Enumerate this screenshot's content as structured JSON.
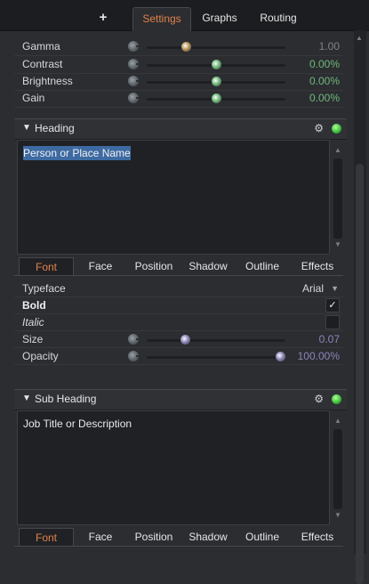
{
  "top_tabs": {
    "add_label": "+",
    "settings": "Settings",
    "graphs": "Graphs",
    "routing": "Routing"
  },
  "adjustments": [
    {
      "label": "Gamma",
      "value": "1.00",
      "position": 0.27,
      "thumb_color": "#b8955a"
    },
    {
      "label": "Contrast",
      "value": "0.00%",
      "position": 0.5,
      "thumb_color": "#6fb87a"
    },
    {
      "label": "Brightness",
      "value": "0.00%",
      "position": 0.5,
      "thumb_color": "#6fb87a"
    },
    {
      "label": "Gain",
      "value": "0.00%",
      "position": 0.5,
      "thumb_color": "#6fb87a"
    }
  ],
  "heading": {
    "title": "Heading",
    "text": "Person or Place Name",
    "tabs": [
      "Font",
      "Face",
      "Position",
      "Shadow",
      "Outline",
      "Effects"
    ],
    "active_tab": "Font",
    "typeface_label": "Typeface",
    "typeface_value": "Arial",
    "bold_label": "Bold",
    "bold_checked": "✓",
    "italic_label": "Italic",
    "size_label": "Size",
    "size_value": "0.07",
    "size_position": 0.26,
    "opacity_label": "Opacity",
    "opacity_value": "100.00%",
    "opacity_position": 1.0,
    "slider_color": "#8a86b8"
  },
  "sub_heading": {
    "title": "Sub Heading",
    "text": "Job Title or Description",
    "tabs": [
      "Font",
      "Face",
      "Position",
      "Shadow",
      "Outline",
      "Effects"
    ],
    "active_tab": "Font"
  },
  "colors": {
    "accent": "#e0824a",
    "status_led": "#3cc13c"
  }
}
